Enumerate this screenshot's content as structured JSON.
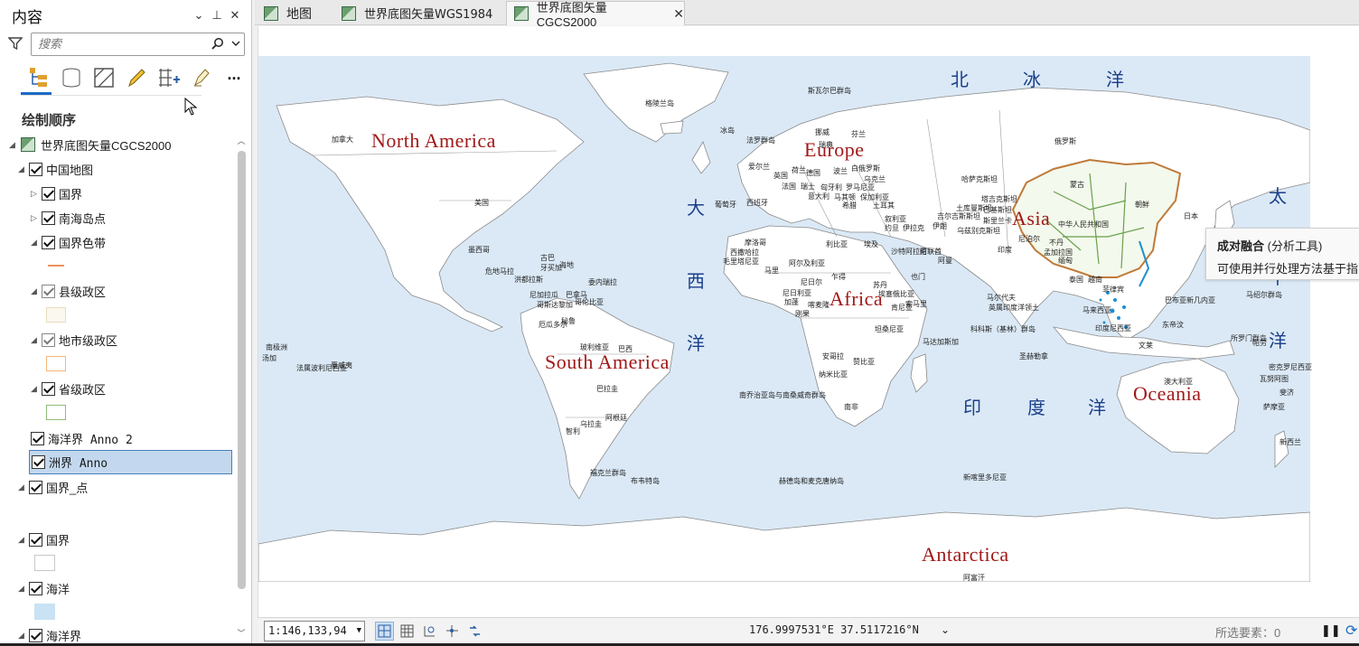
{
  "pane": {
    "title": "内容",
    "ctrl_menu": "⌄",
    "ctrl_pin": "⊥",
    "ctrl_close": "✕",
    "search_placeholder": "搜索",
    "drawing_order": "绘制顺序",
    "more": "..."
  },
  "tree": [
    {
      "label": "世界底图矢量CGCS2000",
      "type": "map"
    },
    {
      "label": "中国地图",
      "type": "group"
    },
    {
      "label": "国界",
      "type": "layer"
    },
    {
      "label": "南海岛点",
      "type": "layer"
    },
    {
      "label": "国界色带",
      "type": "layer"
    },
    {
      "label": "县级政区",
      "type": "layer"
    },
    {
      "label": "地市级政区",
      "type": "layer"
    },
    {
      "label": "省级政区",
      "type": "layer"
    },
    {
      "label": "海洋界 Anno 2",
      "type": "anno"
    },
    {
      "label": "洲界 Anno",
      "type": "anno",
      "selected": true
    },
    {
      "label": "国界_点",
      "type": "group"
    },
    {
      "label": "国界",
      "type": "layer"
    },
    {
      "label": "海洋",
      "type": "layer"
    },
    {
      "label": "海洋界",
      "type": "layer"
    }
  ],
  "tabs": [
    {
      "label": "地图"
    },
    {
      "label": "世界底图矢量WGS1984"
    },
    {
      "label": "世界底图矢量CGCS2000",
      "active": true
    }
  ],
  "map": {
    "continents": [
      "North America",
      "Europe",
      "Asia",
      "Africa",
      "South America",
      "Oceania",
      "Antarctica"
    ],
    "oceans": [
      "北",
      "冰",
      "洋",
      "大",
      "西",
      "洋",
      "太",
      "平",
      "洋",
      "印",
      "度",
      "洋"
    ],
    "countries": [
      "格陵兰岛",
      "斯瓦尔巴群岛",
      "冰岛",
      "法罗群岛",
      "挪威",
      "芬兰",
      "瑞典",
      "俄罗斯",
      "美国",
      "加拿大",
      "爱尔兰",
      "荷兰",
      "德国",
      "白俄罗斯",
      "波兰",
      "英国",
      "乌克兰",
      "法国",
      "瑞士",
      "匈牙利",
      "罗马尼亚",
      "西班牙",
      "意大利",
      "马其顿",
      "保加利亚",
      "葡萄牙",
      "希腊",
      "土耳其",
      "哈萨克斯坦",
      "蒙古",
      "中华人民共和国",
      "朝鲜",
      "日本",
      "尼泊尔",
      "不丹",
      "孟加拉国",
      "缅甸",
      "泰国",
      "越南",
      "菲律宾",
      "马来西亚",
      "印度",
      "印度尼西亚",
      "伊朗",
      "伊拉克",
      "叙利亚",
      "约旦",
      "沙特阿拉伯",
      "也门",
      "阿曼",
      "阿联酋",
      "埃及",
      "利比亚",
      "阿尔及利亚",
      "摩洛哥",
      "西撒哈拉",
      "毛里塔尼亚",
      "马里",
      "尼日尔",
      "乍得",
      "苏丹",
      "尼日利亚",
      "喀麦隆",
      "加蓬",
      "刚果",
      "安哥拉",
      "纳米比亚",
      "南非",
      "赞比亚",
      "坦桑尼亚",
      "肯尼亚",
      "埃塞俄比亚",
      "索马里",
      "马达加斯加",
      "墨西哥",
      "古巴",
      "海地",
      "牙买加",
      "危地马拉",
      "洪都拉斯",
      "尼加拉瓜",
      "哥斯达黎加",
      "巴拿马",
      "哥伦比亚",
      "委内瑞拉",
      "厄瓜多尔",
      "秘鲁",
      "巴西",
      "玻利维亚",
      "巴拉圭",
      "智利",
      "阿根廷",
      "乌拉圭",
      "福克兰群岛",
      "澳大利亚",
      "新西兰",
      "巴布亚新几内亚",
      "所罗门群岛",
      "斐济",
      "萨摩亚",
      "汤加",
      "法属波利尼西亚",
      "夏威夷",
      "南极洲",
      "阿富汗",
      "巴基斯坦",
      "乌兹别克斯坦",
      "土库曼斯坦",
      "吉尔吉斯斯坦",
      "塔吉克斯坦",
      "斯里兰卡",
      "马尔代夫",
      "英属印度洋领土",
      "科科斯（基林）群岛",
      "圣赫勒拿",
      "南乔治亚岛与南桑威奇群岛",
      "布韦特岛",
      "赫德岛和麦克唐纳岛",
      "新喀里多尼亚",
      "瓦努阿图",
      "密克罗尼西亚",
      "马绍尔群岛",
      "帕劳",
      "东帝汶",
      "文莱"
    ]
  },
  "tooltip": {
    "tool": "成对融合",
    "category": "(分析工具)",
    "desc": "可使用并行处理方法基于指"
  },
  "status": {
    "scale": "1:146,133,94",
    "coords": "176.9997531°E 37.5117216°N",
    "selected": "所选要素：0"
  },
  "colors": {
    "ocean": "#dbe9f6",
    "land": "#ffffff",
    "border": "#8a8a8a",
    "continent_label": "#a11818",
    "ocean_label": "#1b3f8a",
    "china_province": "#6aa04b",
    "china_border": "#c07a3a",
    "south_sea": "#1e8fd0",
    "accent": "#1c6bc6"
  }
}
